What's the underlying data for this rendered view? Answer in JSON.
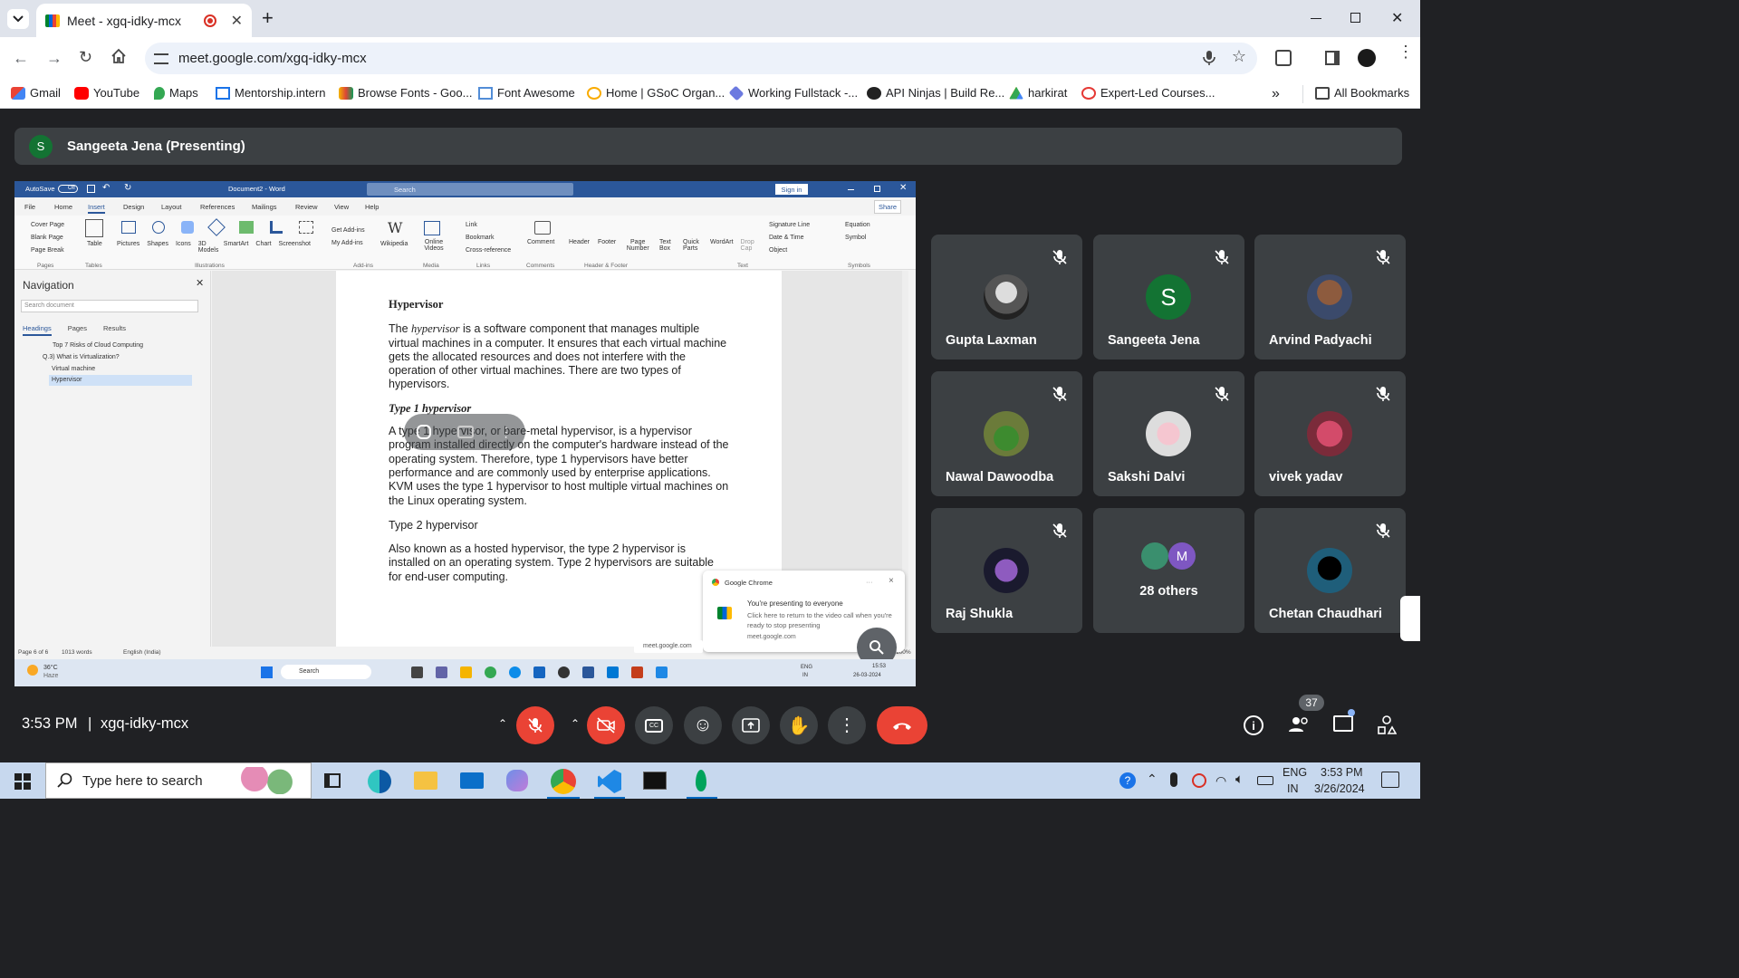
{
  "browser": {
    "tab_title": "Meet - xgq-idky-mcx",
    "new_tab_glyph": "+",
    "url": "meet.google.com/xgq-idky-mcx",
    "bookmarks": [
      "Gmail",
      "YouTube",
      "Maps",
      "Mentorship.intern",
      "Browse Fonts - Goo...",
      "Font Awesome",
      "Home | GSoC Organ...",
      "Working Fullstack -...",
      "API Ninjas | Build Re...",
      "harkirat",
      "Expert-Led Courses..."
    ],
    "all_bookmarks": "All Bookmarks",
    "more_glyph": "»"
  },
  "meet": {
    "presenter_initial": "S",
    "presenter_label": "Sangeeta Jena (Presenting)",
    "participants": [
      {
        "name": "Gupta Laxman"
      },
      {
        "name": "Sangeeta Jena",
        "initial": "S"
      },
      {
        "name": "Arvind Padyachi"
      },
      {
        "name": "Nawal Dawoodba"
      },
      {
        "name": "Sakshi Dalvi"
      },
      {
        "name": "vivek yadav"
      },
      {
        "name": "Raj Shukla"
      },
      {
        "name": "28 others",
        "initial": "M"
      },
      {
        "name": "Chetan Chaudhari"
      }
    ],
    "time": "3:53 PM",
    "separator": "|",
    "meeting_code": "xgq-idky-mcx",
    "people_count": "37",
    "colors": {
      "end_call": "#ea4335",
      "muted": "#ea4335",
      "tile": "#3c4043",
      "background": "#202124"
    }
  },
  "word": {
    "autosave": "AutoSave",
    "autosave_state": "Off",
    "doc_title": "Document2 - Word",
    "search": "Search",
    "sign_in": "Sign in",
    "share": "Share",
    "menu": [
      "File",
      "Home",
      "Insert",
      "Design",
      "Layout",
      "References",
      "Mailings",
      "Review",
      "View",
      "Help"
    ],
    "ribbon": {
      "pages": [
        "Cover Page",
        "Blank Page",
        "Page Break"
      ],
      "pages_group": "Pages",
      "table": "Table",
      "tables_group": "Tables",
      "illustrations": [
        "Pictures",
        "Shapes",
        "Icons",
        "3D Models",
        "SmartArt",
        "Chart",
        "Screenshot"
      ],
      "illustrations_group": "Illustrations",
      "addins": [
        "Get Add-ins",
        "My Add-ins",
        "Wikipedia"
      ],
      "addins_group": "Add-ins",
      "media": "Online Videos",
      "media_group": "Media",
      "links": [
        "Link",
        "Bookmark",
        "Cross-reference"
      ],
      "links_group": "Links",
      "comment": "Comment",
      "comments_group": "Comments",
      "hf": [
        "Header",
        "Footer",
        "Page Number"
      ],
      "hf_group": "Header & Footer",
      "text": [
        "Text Box",
        "Quick Parts",
        "WordArt",
        "Drop Cap"
      ],
      "text_small": [
        "Signature Line",
        "Date & Time",
        "Object"
      ],
      "text_group": "Text",
      "symbols": [
        "Equation",
        "Symbol"
      ],
      "symbols_group": "Symbols"
    },
    "nav": {
      "title": "Navigation",
      "search_placeholder": "Search document",
      "tabs": [
        "Headings",
        "Pages",
        "Results"
      ],
      "items": [
        "Top 7 Risks of Cloud Computing",
        "Q.3) What is Virtualization?",
        "Virtual machine",
        "Hypervisor"
      ]
    },
    "doc": {
      "heading": "Hypervisor",
      "p1_pre": "The ",
      "p1_em": "hypervisor",
      "p1_post": " is a software component that manages multiple virtual machines in a computer. It ensures that each virtual machine gets the allocated resources and does not interfere with the operation of other virtual machines. There are two types of hypervisors.",
      "h2": "Type 1 hypervisor",
      "p2": "A type 1 hypervisor, or bare-metal hypervisor, is a hypervisor program installed directly on the computer's hardware instead of the operating system. Therefore, type 1 hypervisors have better performance and are commonly used by enterprise applications. KVM uses the type 1 hypervisor to host multiple virtual machines on the Linux operating system.",
      "h3": "Type 2 hypervisor",
      "p3": "Also known as a hosted hypervisor, the type 2 hypervisor is installed on an operating system. Type 2 hypervisors are suitable for end-user computing."
    },
    "status": {
      "page": "Page 6 of 6",
      "words": "1013 words",
      "lang": "English (India)",
      "zoom": "100%"
    },
    "popup": {
      "app": "Google Chrome",
      "title": "You're presenting to everyone",
      "body": "Click here to return to the video call when you're ready to stop presenting",
      "url": "meet.google.com",
      "dots": "···",
      "close": "×"
    },
    "meet_url_chip": "meet.google.com",
    "inner_taskbar": {
      "temp": "36°C",
      "weather": "Haze",
      "search": "Search",
      "lang1": "ENG",
      "lang2": "IN",
      "time": "15:53",
      "date": "26-03-2024"
    }
  },
  "taskbar": {
    "search_placeholder": "Type here to search",
    "lang1": "ENG",
    "lang2": "IN",
    "time": "3:53 PM",
    "date": "3/26/2024"
  }
}
